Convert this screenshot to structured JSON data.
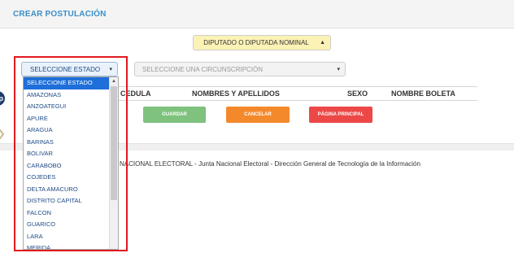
{
  "header": {
    "title": "CREAR POSTULACIÓN"
  },
  "form": {
    "cargo_select": "DIPUTADO O DIPUTADA NOMINAL",
    "estado_select": "SELECCIONE ESTADO",
    "circunscripcion_select": "SELECCIONE UNA CIRCUNSCRIPCIÓN"
  },
  "table": {
    "columns": [
      "CEDULA",
      "NOMBRES Y APELLIDOS",
      "SEXO",
      "NOMBRE BOLETA"
    ]
  },
  "buttons": {
    "save": "GUARDAR",
    "cancel": "CANCELAR",
    "main_page": "PÁGINA PRINCIPAL"
  },
  "footer": {
    "text": "NACIONAL ELECTORAL - Junta Nacional Electoral - Dirección General de Tecnología de la Información"
  },
  "dropdown": {
    "selected_index": 0,
    "options": [
      "SELECCIONE ESTADO",
      "AMAZONAS",
      "ANZOATEGUI",
      "APURE",
      "ARAGUA",
      "BARINAS",
      "BOLIVAR",
      "CARABOBO",
      "COJEDES",
      "DELTA AMACURO",
      "DISTRITO CAPITAL",
      "FALCON",
      "GUARICO",
      "LARA",
      "MERIDA"
    ]
  },
  "overlay": {
    "badge": "p"
  },
  "colors": {
    "title": "#3a8fc8",
    "save": "#7ec27e",
    "cancel": "#f4892c",
    "main_page": "#ec4848",
    "highlight": "#e0191f",
    "selected_option": "#1e6fd9"
  }
}
